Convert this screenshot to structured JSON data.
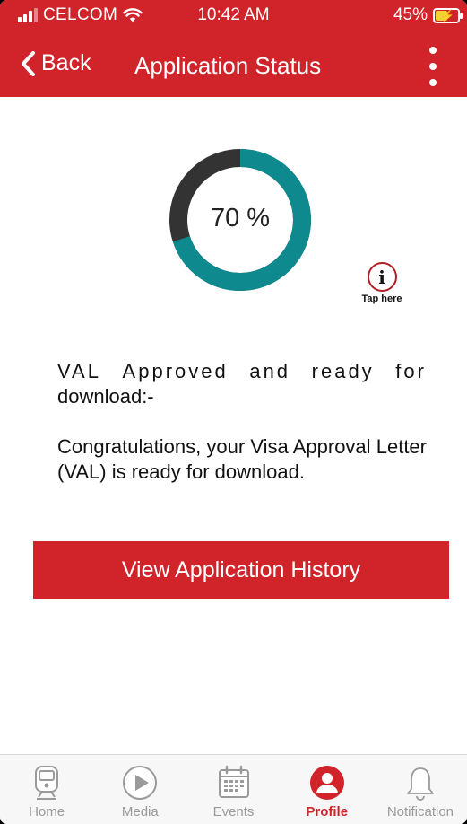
{
  "status_bar": {
    "carrier": "CELCOM",
    "time": "10:42 AM",
    "battery": "45%"
  },
  "nav": {
    "back_label": "Back",
    "title": "Application Status"
  },
  "progress": {
    "value": 70,
    "label": "70 %",
    "fill_color": "#0e8a8f",
    "track_color": "#333333"
  },
  "info": {
    "icon_glyph": "i",
    "label": "Tap here"
  },
  "message": {
    "title_words": [
      "VAL",
      "Approved",
      "and",
      "ready",
      "for"
    ],
    "title_line2": "download:-",
    "body": "Congratulations, your Visa Approval Letter (VAL) is ready for download."
  },
  "history_button": "View Application History",
  "tabs": [
    {
      "label": "Home",
      "icon": "train-icon",
      "active": false
    },
    {
      "label": "Media",
      "icon": "play-icon",
      "active": false
    },
    {
      "label": "Events",
      "icon": "calendar-icon",
      "active": false
    },
    {
      "label": "Profile",
      "icon": "profile-icon",
      "active": true
    },
    {
      "label": "Notification",
      "icon": "bell-icon",
      "active": false
    }
  ],
  "colors": {
    "brand_red": "#d0242a",
    "teal": "#0e8a8f"
  }
}
